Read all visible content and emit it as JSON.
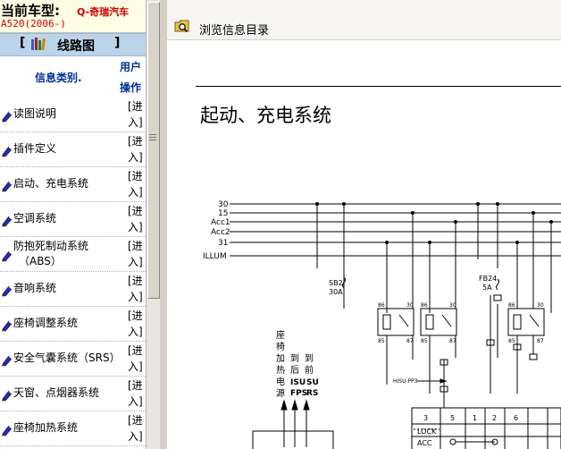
{
  "car": {
    "label": "当前车型:",
    "brand": "Q-奇瑞汽车",
    "model": "A520(2006-)"
  },
  "section": {
    "bracket_left": "[",
    "title": "线路图",
    "bracket_right": "]"
  },
  "columns": {
    "category": "信息类别.",
    "user": "用户",
    "action": "操作"
  },
  "items": [
    {
      "label": "读图说明",
      "label2": "",
      "op1": "[进",
      "op2": "入]"
    },
    {
      "label": "插件定义",
      "label2": "",
      "op1": "[进",
      "op2": "入]"
    },
    {
      "label": "启动、充电系统",
      "label2": "",
      "op1": "[进",
      "op2": "入]"
    },
    {
      "label": "空调系统",
      "label2": "",
      "op1": "[进",
      "op2": "入]"
    },
    {
      "label": "防抱死制动系统",
      "label2": "（ABS）",
      "op1": "[进",
      "op2": "入]"
    },
    {
      "label": "音响系统",
      "label2": "",
      "op1": "[进",
      "op2": "入]"
    },
    {
      "label": "座椅调整系统",
      "label2": "",
      "op1": "[进",
      "op2": "入]"
    },
    {
      "label": "安全气囊系统（SRS）",
      "label2": "",
      "op1": "[进",
      "op2": "入]"
    },
    {
      "label": "天窗、点烟器系统",
      "label2": "",
      "op1": "[进",
      "op2": "入]"
    },
    {
      "label": "座椅加热系统",
      "label2": "",
      "op1": "[进",
      "op2": "入]"
    }
  ],
  "toolbar": {
    "browse_label": "浏览信息目录"
  },
  "document": {
    "title": "起动、充电系统"
  },
  "schematic": {
    "rails": [
      "30",
      "15",
      "Acc1",
      "Acc2",
      "31",
      "ILLUM"
    ],
    "fuse1": {
      "name": "SB2",
      "rating": "30A"
    },
    "fuse2": {
      "name": "FB24",
      "rating": "5A"
    },
    "vertical_labels": {
      "seat": [
        "座",
        "椅",
        "加",
        "热",
        "电",
        "源"
      ],
      "rear": [
        "到",
        "后"
      ],
      "front": [
        "到",
        "前"
      ]
    },
    "relay_pins": [
      "86",
      "30",
      "85",
      "87"
    ],
    "connector_label": "HISU PP3",
    "table_header": [
      "3",
      "5",
      "1",
      "2",
      "6"
    ],
    "table_rows": [
      "LOCK",
      "ACC"
    ],
    "small_codes": [
      "ISU",
      "SU",
      "FPS",
      "RS",
      "FPS"
    ]
  },
  "colors": {
    "car_label": "#000000",
    "car_brand": "#cc0000",
    "section_bar": "#bcd4ea",
    "column_head": "#003399",
    "item_icon": "#2b2bb0"
  },
  "icons": {
    "item": "pencil-bullet-icon",
    "section": "books-icon",
    "toolbar": "folder-search-icon"
  }
}
